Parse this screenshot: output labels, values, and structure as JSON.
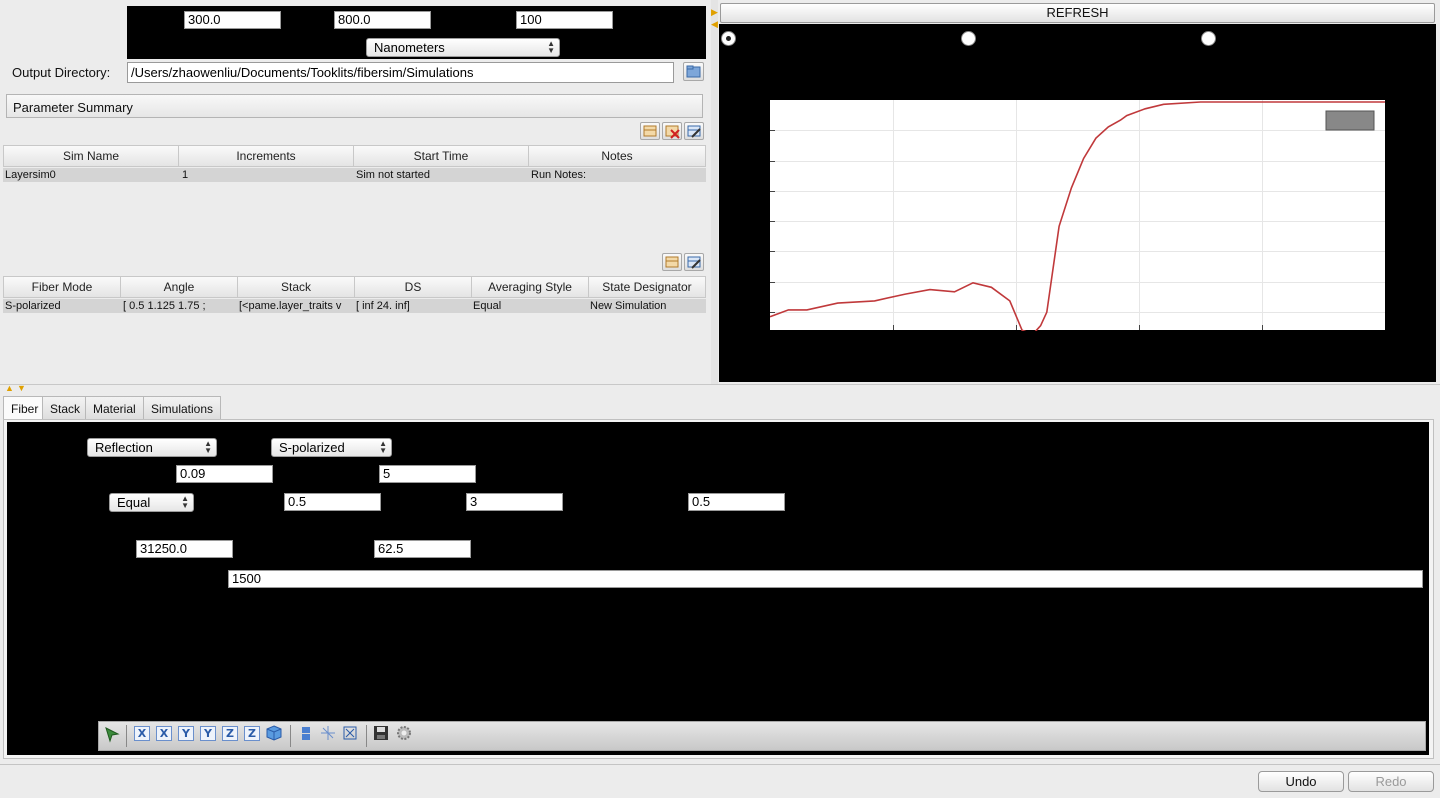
{
  "top": {
    "field1": "300.0",
    "field2": "800.0",
    "field3": "100",
    "units": "Nanometers",
    "output_dir_label": "Output Directory:",
    "output_dir": "/Users/zhaowenliu/Documents/Tooklits/fibersim/Simulations"
  },
  "summary": {
    "title": "Parameter Summary",
    "sim_columns": [
      "Sim Name",
      "Increments",
      "Start Time",
      "Notes"
    ],
    "sim_rows": [
      [
        "Layersim0",
        "1",
        "Sim not started",
        "Run Notes:"
      ]
    ],
    "fiber_columns": [
      "Fiber Mode",
      "Angle",
      "Stack",
      "DS",
      "Averaging Style",
      "State Designator"
    ],
    "fiber_rows": [
      [
        "S-polarized",
        "[ 0.5    1.125   1.75   ;",
        "[<pame.layer_traits v",
        "[ inf  24.  inf]",
        "Equal",
        "New Simulation"
      ]
    ]
  },
  "plot": {
    "refresh": "REFRESH"
  },
  "chart_data": {
    "type": "line",
    "title": "",
    "xlabel": "",
    "ylabel": "",
    "xlim": [
      0,
      100
    ],
    "ylim": [
      0,
      100
    ],
    "grid": true,
    "legend": "top-right",
    "series": [
      {
        "color": "#c0393b",
        "x": [
          0,
          3,
          6,
          11,
          17,
          22,
          26,
          30,
          33,
          36,
          39,
          41,
          42,
          43,
          44,
          45,
          47,
          49,
          51,
          53,
          55,
          57,
          58,
          61,
          64,
          70,
          76,
          82,
          88,
          94,
          100
        ],
        "y": [
          5,
          8,
          8,
          11,
          12,
          15,
          17,
          16,
          20,
          18,
          12,
          -1,
          -2,
          -2,
          1,
          7,
          45,
          62,
          75,
          84,
          89,
          92,
          94,
          97,
          99,
          100,
          100,
          100,
          100,
          100,
          100
        ]
      }
    ],
    "colors": {
      "plot_bg": "#ffffff",
      "outer_bg": "#000000",
      "legend_box": "#888888"
    }
  },
  "tabs": [
    "Fiber",
    "Stack",
    "Material",
    "Simulations"
  ],
  "fiber": {
    "mode_type": "Reflection",
    "polarization": "S-polarized",
    "val_a": "0.09",
    "val_b": "5",
    "averaging": "Equal",
    "angle_start": "0.5",
    "angle_steps": "3",
    "angle_end": "0.5",
    "val_c": "31250.0",
    "val_d": "62.5",
    "val_e": "1500"
  },
  "toolbar": {
    "icons": [
      "select-arrow-icon",
      "view-x-icon",
      "view-neg-x-icon",
      "view-y-icon",
      "view-neg-y-icon",
      "view-z-icon",
      "view-neg-z-icon",
      "isometric-cube-icon",
      "parallel-projection-icon",
      "axes-icon",
      "fullscreen-icon",
      "save-icon",
      "settings-gear-icon"
    ],
    "x_label": "X",
    "y_label": "Y",
    "z_label": "Z"
  },
  "footer": {
    "undo": "Undo",
    "redo": "Redo"
  }
}
